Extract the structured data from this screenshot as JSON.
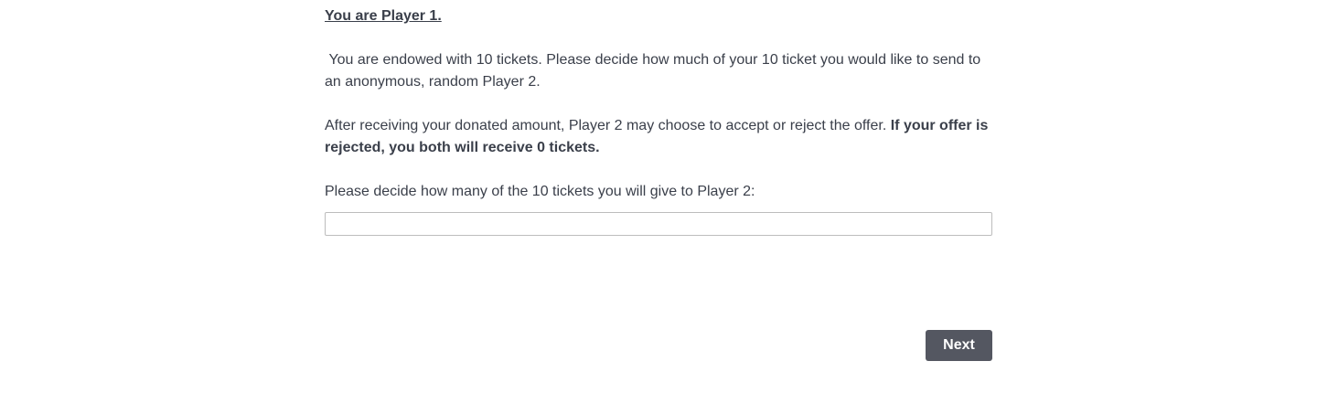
{
  "question": {
    "heading": "You are Player 1.",
    "paragraph_1": " You are endowed with 10 tickets. Please decide how much of your 10 ticket you would like to send to an anonymous, random Player 2.",
    "paragraph_2_plain": "After receiving your donated amount, Player 2 may choose to accept or reject the offer. ",
    "paragraph_2_bold": "If your offer is rejected, you both will receive 0 tickets.",
    "prompt": "Please decide how many of the 10 tickets you will give to Player 2:"
  },
  "answer": {
    "value": "",
    "placeholder": ""
  },
  "navigation": {
    "next_label": "Next"
  },
  "colors": {
    "text": "#3a3f4a",
    "button_bg": "#545761",
    "button_text": "#ffffff",
    "input_border": "#bdbdbd"
  }
}
